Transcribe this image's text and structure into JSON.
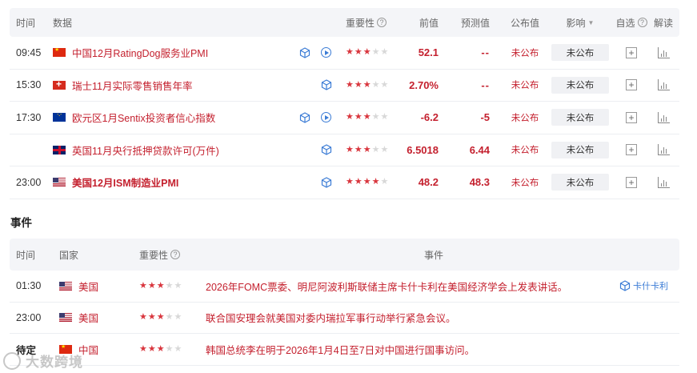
{
  "data_table": {
    "headers": {
      "time": "时间",
      "data": "数据",
      "importance": "重要性",
      "previous": "前值",
      "forecast": "预测值",
      "actual": "公布值",
      "effect": "影响",
      "self_select": "自选",
      "interpret": "解读"
    },
    "rows": [
      {
        "time": "09:45",
        "flag": "cn-flag-icon",
        "name": "中国12月RatingDog服务业PMI",
        "bold": false,
        "cube": true,
        "video": true,
        "stars": 3,
        "previous": "52.1",
        "forecast": "--",
        "actual": "未公布",
        "effect": "未公布"
      },
      {
        "time": "15:30",
        "flag": "ch-flag-icon",
        "name": "瑞士11月实际零售销售年率",
        "bold": false,
        "cube": true,
        "video": false,
        "stars": 3,
        "previous": "2.70%",
        "forecast": "--",
        "actual": "未公布",
        "effect": "未公布"
      },
      {
        "time": "17:30",
        "flag": "eu-flag-icon",
        "name": "欧元区1月Sentix投资者信心指数",
        "bold": false,
        "cube": true,
        "video": true,
        "stars": 3,
        "previous": "-6.2",
        "forecast": "-5",
        "actual": "未公布",
        "effect": "未公布"
      },
      {
        "time": "",
        "flag": "gb-flag-icon",
        "name": "英国11月央行抵押贷款许可(万件)",
        "bold": false,
        "cube": true,
        "video": false,
        "stars": 3,
        "previous": "6.5018",
        "forecast": "6.44",
        "actual": "未公布",
        "effect": "未公布"
      },
      {
        "time": "23:00",
        "flag": "us-flag-icon",
        "name": "美国12月ISM制造业PMI",
        "bold": true,
        "cube": true,
        "video": false,
        "stars": 4,
        "previous": "48.2",
        "forecast": "48.3",
        "actual": "未公布",
        "effect": "未公布"
      }
    ]
  },
  "events_section": {
    "title": "事件",
    "headers": {
      "time": "时间",
      "country": "国家",
      "importance": "重要性",
      "event": "事件"
    },
    "rows": [
      {
        "time": "01:30",
        "time_bold": false,
        "flag": "us-flag-icon",
        "country": "美国",
        "stars": 3,
        "event": "2026年FOMC票委、明尼阿波利斯联储主席卡什卡利在美国经济学会上发表讲话。",
        "person": "卡什卡利"
      },
      {
        "time": "23:00",
        "time_bold": false,
        "flag": "us-flag-icon",
        "country": "美国",
        "stars": 3,
        "event": "联合国安理会就美国对委内瑞拉军事行动举行紧急会议。",
        "person": ""
      },
      {
        "time": "待定",
        "time_bold": true,
        "flag": "cn-flag-icon",
        "country": "中国",
        "stars": 3,
        "event": "韩国总统李在明于2026年1月4日至7日对中国进行国事访问。",
        "person": ""
      }
    ]
  },
  "watermark": "大数跨境",
  "colors": {
    "accent_red": "#c4202e",
    "link_blue": "#3a7bd5",
    "star_on": "#d9363e",
    "star_off": "#d8d8d8"
  }
}
